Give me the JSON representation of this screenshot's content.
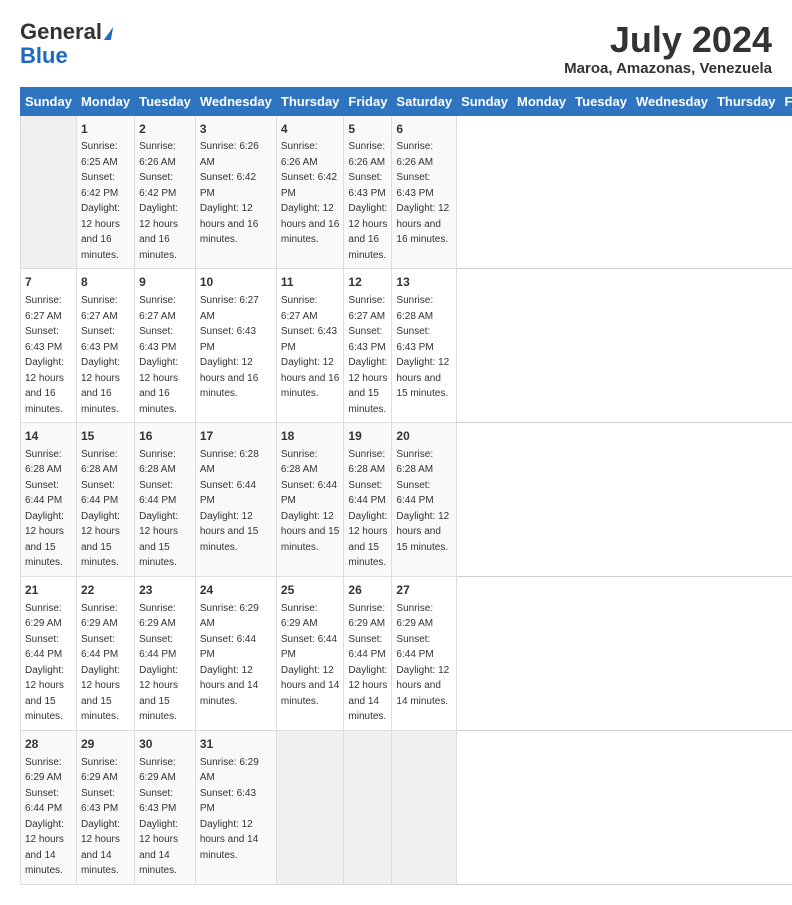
{
  "header": {
    "logo_general": "General",
    "logo_blue": "Blue",
    "month_title": "July 2024",
    "location": "Maroa, Amazonas, Venezuela"
  },
  "calendar": {
    "days_of_week": [
      "Sunday",
      "Monday",
      "Tuesday",
      "Wednesday",
      "Thursday",
      "Friday",
      "Saturday"
    ],
    "weeks": [
      [
        {
          "day": "",
          "info": ""
        },
        {
          "day": "1",
          "info": "Sunrise: 6:25 AM\nSunset: 6:42 PM\nDaylight: 12 hours and 16 minutes."
        },
        {
          "day": "2",
          "info": "Sunrise: 6:26 AM\nSunset: 6:42 PM\nDaylight: 12 hours and 16 minutes."
        },
        {
          "day": "3",
          "info": "Sunrise: 6:26 AM\nSunset: 6:42 PM\nDaylight: 12 hours and 16 minutes."
        },
        {
          "day": "4",
          "info": "Sunrise: 6:26 AM\nSunset: 6:42 PM\nDaylight: 12 hours and 16 minutes."
        },
        {
          "day": "5",
          "info": "Sunrise: 6:26 AM\nSunset: 6:43 PM\nDaylight: 12 hours and 16 minutes."
        },
        {
          "day": "6",
          "info": "Sunrise: 6:26 AM\nSunset: 6:43 PM\nDaylight: 12 hours and 16 minutes."
        }
      ],
      [
        {
          "day": "7",
          "info": "Sunrise: 6:27 AM\nSunset: 6:43 PM\nDaylight: 12 hours and 16 minutes."
        },
        {
          "day": "8",
          "info": "Sunrise: 6:27 AM\nSunset: 6:43 PM\nDaylight: 12 hours and 16 minutes."
        },
        {
          "day": "9",
          "info": "Sunrise: 6:27 AM\nSunset: 6:43 PM\nDaylight: 12 hours and 16 minutes."
        },
        {
          "day": "10",
          "info": "Sunrise: 6:27 AM\nSunset: 6:43 PM\nDaylight: 12 hours and 16 minutes."
        },
        {
          "day": "11",
          "info": "Sunrise: 6:27 AM\nSunset: 6:43 PM\nDaylight: 12 hours and 16 minutes."
        },
        {
          "day": "12",
          "info": "Sunrise: 6:27 AM\nSunset: 6:43 PM\nDaylight: 12 hours and 15 minutes."
        },
        {
          "day": "13",
          "info": "Sunrise: 6:28 AM\nSunset: 6:43 PM\nDaylight: 12 hours and 15 minutes."
        }
      ],
      [
        {
          "day": "14",
          "info": "Sunrise: 6:28 AM\nSunset: 6:44 PM\nDaylight: 12 hours and 15 minutes."
        },
        {
          "day": "15",
          "info": "Sunrise: 6:28 AM\nSunset: 6:44 PM\nDaylight: 12 hours and 15 minutes."
        },
        {
          "day": "16",
          "info": "Sunrise: 6:28 AM\nSunset: 6:44 PM\nDaylight: 12 hours and 15 minutes."
        },
        {
          "day": "17",
          "info": "Sunrise: 6:28 AM\nSunset: 6:44 PM\nDaylight: 12 hours and 15 minutes."
        },
        {
          "day": "18",
          "info": "Sunrise: 6:28 AM\nSunset: 6:44 PM\nDaylight: 12 hours and 15 minutes."
        },
        {
          "day": "19",
          "info": "Sunrise: 6:28 AM\nSunset: 6:44 PM\nDaylight: 12 hours and 15 minutes."
        },
        {
          "day": "20",
          "info": "Sunrise: 6:28 AM\nSunset: 6:44 PM\nDaylight: 12 hours and 15 minutes."
        }
      ],
      [
        {
          "day": "21",
          "info": "Sunrise: 6:29 AM\nSunset: 6:44 PM\nDaylight: 12 hours and 15 minutes."
        },
        {
          "day": "22",
          "info": "Sunrise: 6:29 AM\nSunset: 6:44 PM\nDaylight: 12 hours and 15 minutes."
        },
        {
          "day": "23",
          "info": "Sunrise: 6:29 AM\nSunset: 6:44 PM\nDaylight: 12 hours and 15 minutes."
        },
        {
          "day": "24",
          "info": "Sunrise: 6:29 AM\nSunset: 6:44 PM\nDaylight: 12 hours and 14 minutes."
        },
        {
          "day": "25",
          "info": "Sunrise: 6:29 AM\nSunset: 6:44 PM\nDaylight: 12 hours and 14 minutes."
        },
        {
          "day": "26",
          "info": "Sunrise: 6:29 AM\nSunset: 6:44 PM\nDaylight: 12 hours and 14 minutes."
        },
        {
          "day": "27",
          "info": "Sunrise: 6:29 AM\nSunset: 6:44 PM\nDaylight: 12 hours and 14 minutes."
        }
      ],
      [
        {
          "day": "28",
          "info": "Sunrise: 6:29 AM\nSunset: 6:44 PM\nDaylight: 12 hours and 14 minutes."
        },
        {
          "day": "29",
          "info": "Sunrise: 6:29 AM\nSunset: 6:43 PM\nDaylight: 12 hours and 14 minutes."
        },
        {
          "day": "30",
          "info": "Sunrise: 6:29 AM\nSunset: 6:43 PM\nDaylight: 12 hours and 14 minutes."
        },
        {
          "day": "31",
          "info": "Sunrise: 6:29 AM\nSunset: 6:43 PM\nDaylight: 12 hours and 14 minutes."
        },
        {
          "day": "",
          "info": ""
        },
        {
          "day": "",
          "info": ""
        },
        {
          "day": "",
          "info": ""
        }
      ]
    ]
  }
}
